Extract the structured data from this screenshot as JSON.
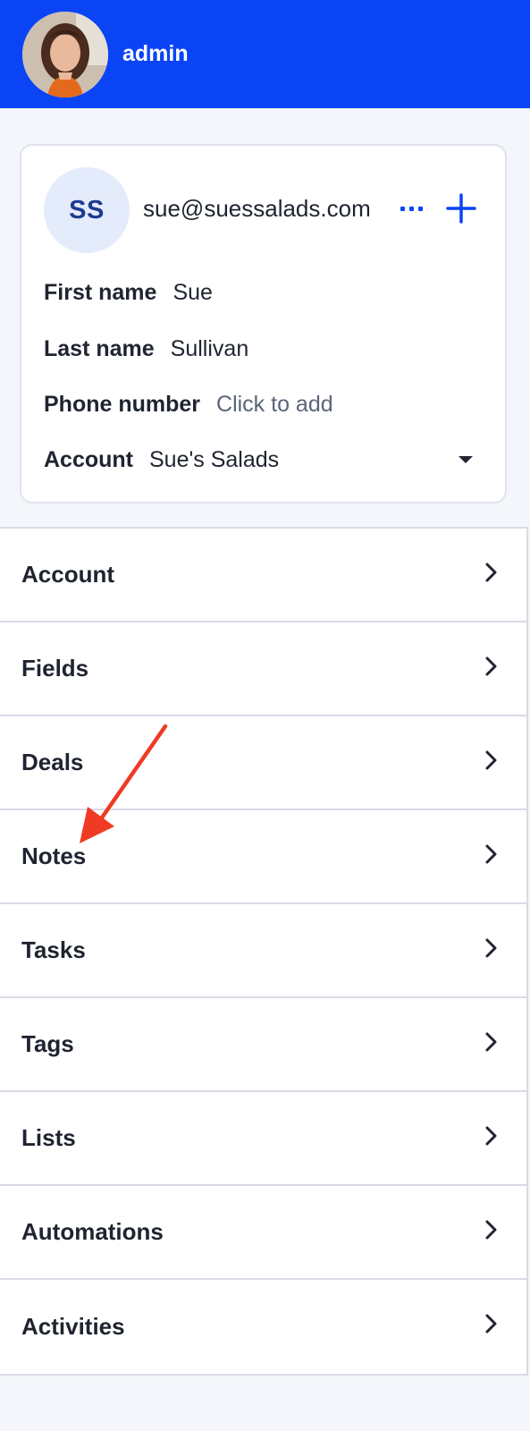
{
  "topbar": {
    "username": "admin",
    "background": "#0a44f5"
  },
  "contact": {
    "initials": "SS",
    "email": "sue@suessalads.com",
    "fields": {
      "first_name": {
        "label": "First name",
        "value": "Sue"
      },
      "last_name": {
        "label": "Last name",
        "value": "Sullivan"
      },
      "phone": {
        "label": "Phone number",
        "placeholder": "Click to add"
      },
      "account": {
        "label": "Account",
        "value": "Sue's Salads"
      }
    },
    "icons": {
      "more": "ellipsis-icon",
      "add": "plus-icon",
      "dropdown": "caret-down-icon"
    }
  },
  "sections": [
    {
      "label": "Account"
    },
    {
      "label": "Fields"
    },
    {
      "label": "Deals"
    },
    {
      "label": "Notes"
    },
    {
      "label": "Tasks"
    },
    {
      "label": "Tags"
    },
    {
      "label": "Lists"
    },
    {
      "label": "Automations"
    },
    {
      "label": "Activities"
    }
  ],
  "colors": {
    "accent": "#0a44f5",
    "annotation": "#f03a24"
  }
}
